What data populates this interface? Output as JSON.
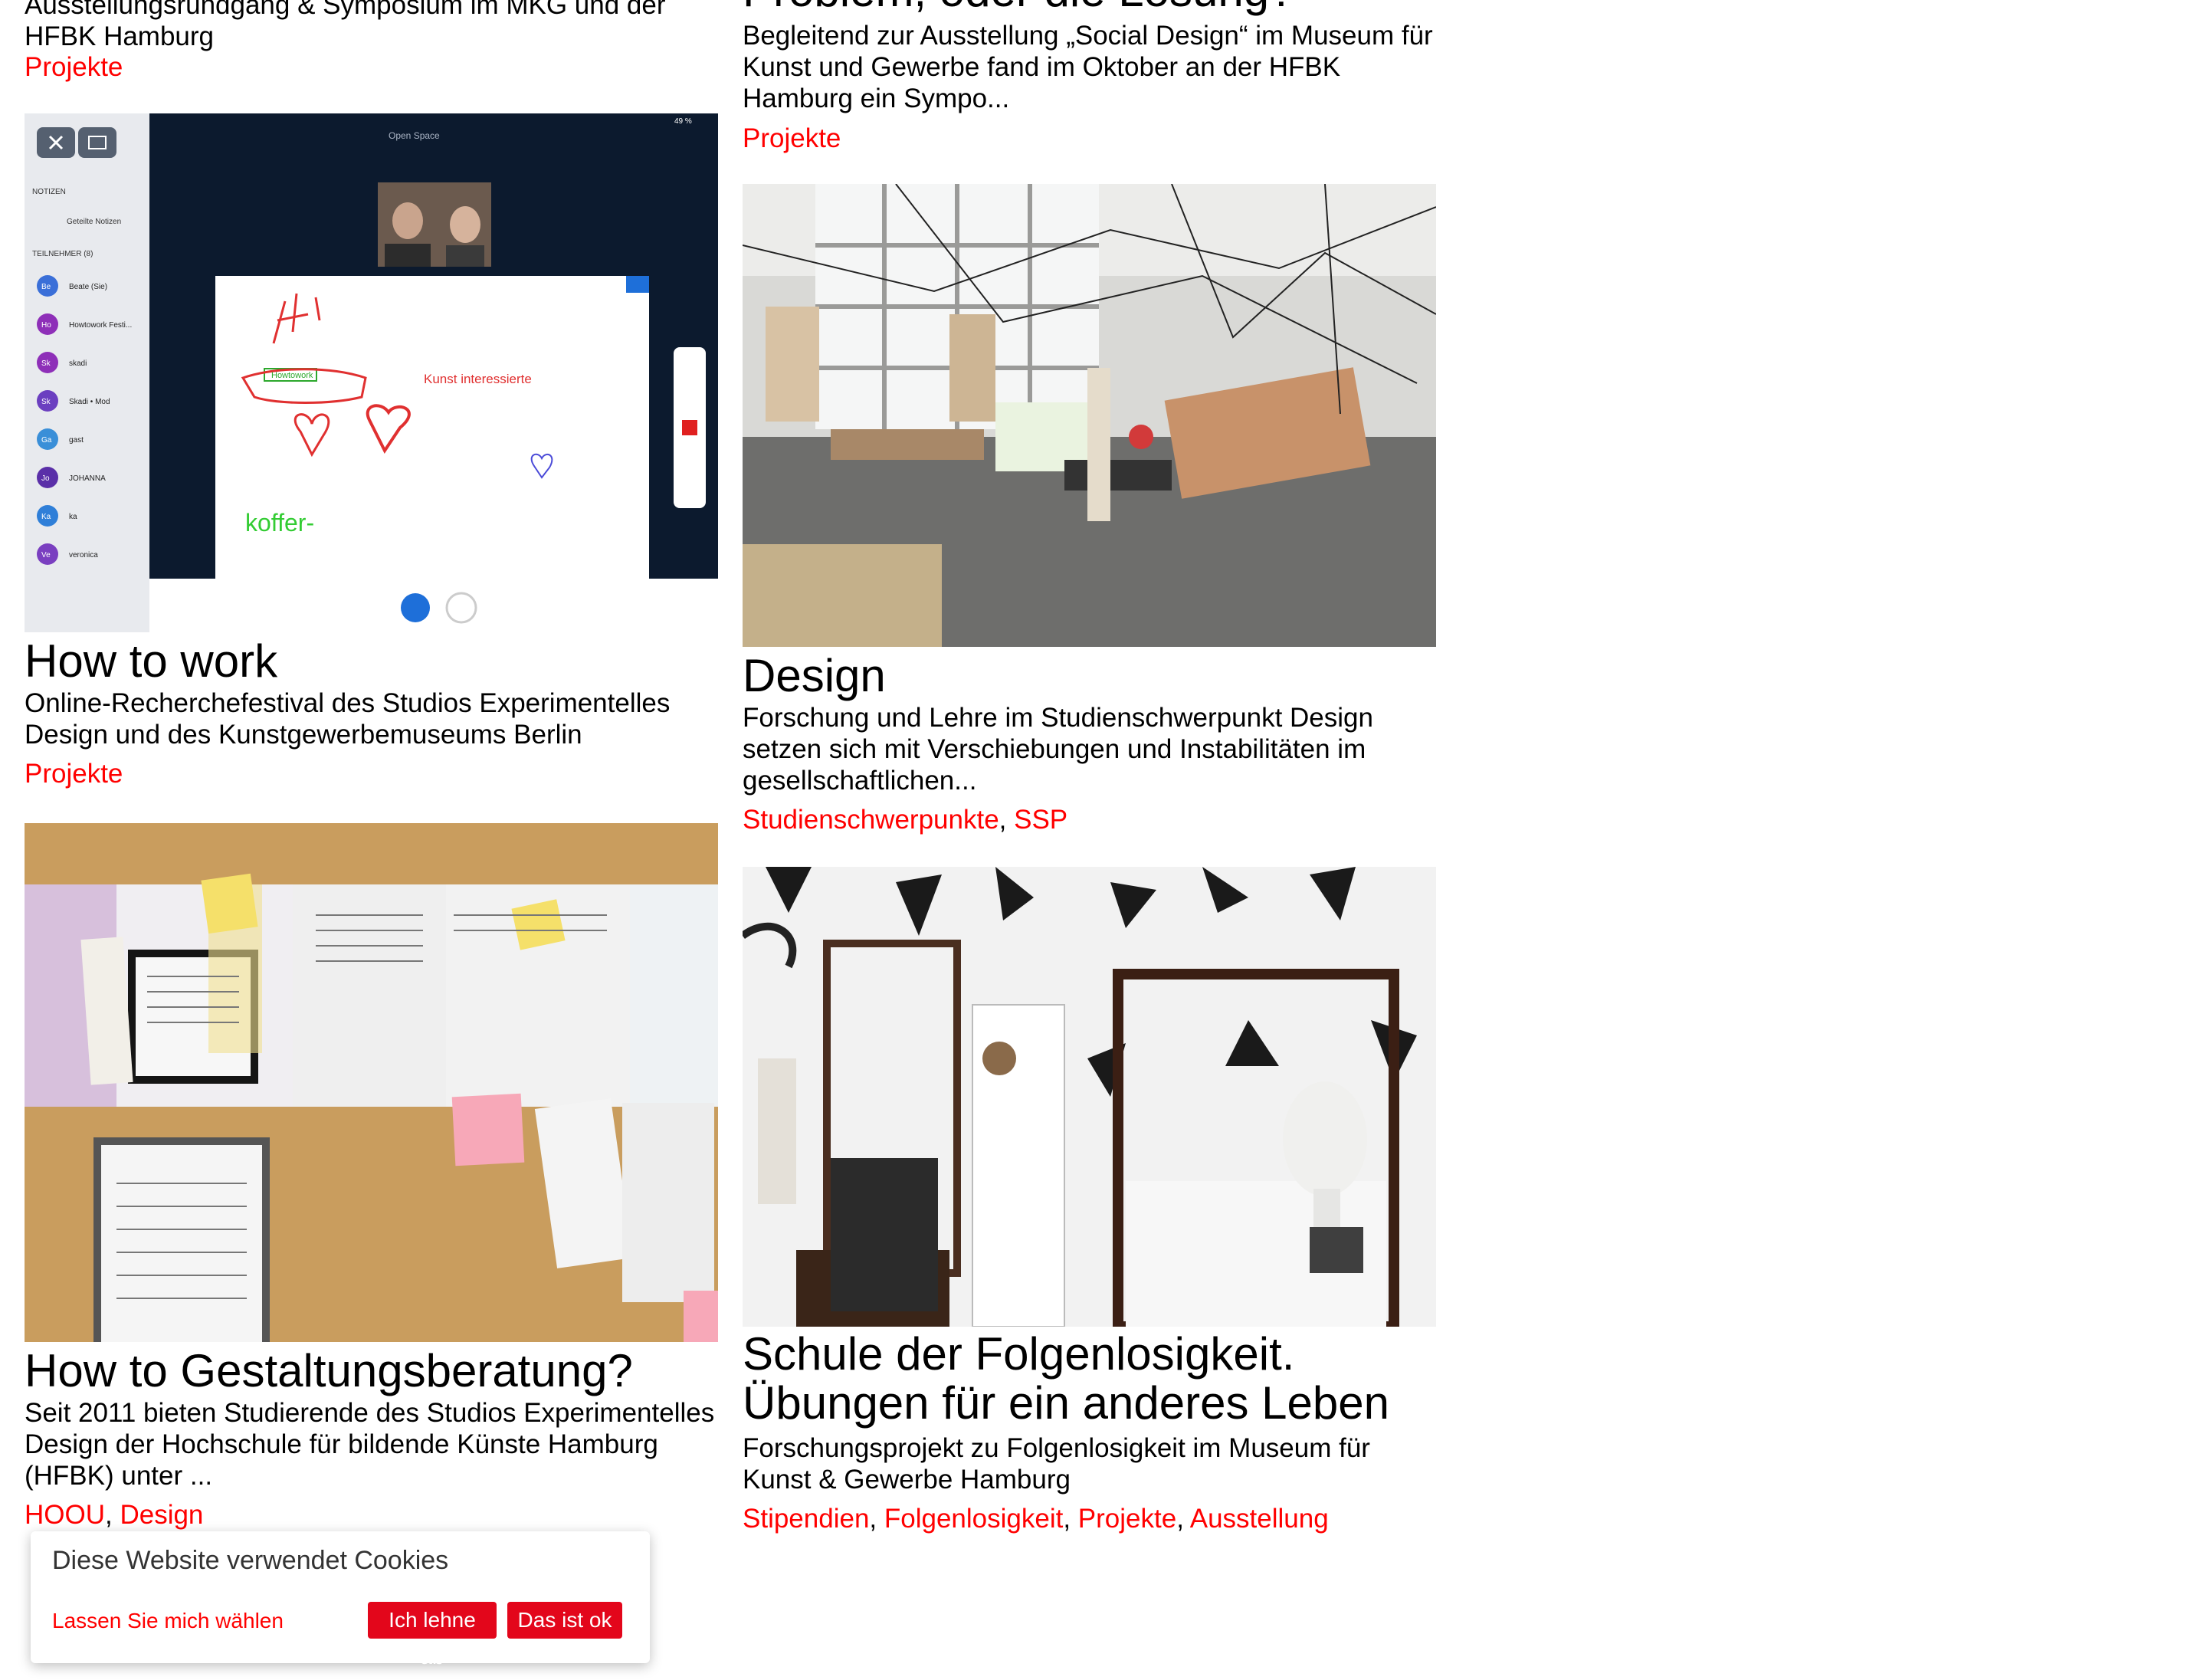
{
  "left_column": {
    "top_partial": {
      "desc": "Ausstellungsrundgang & Symposium im MKG und der HFBK Hamburg",
      "tags": [
        "Projekte"
      ]
    },
    "cards": [
      {
        "title": "How to work",
        "desc": "Online-Recherchefestival des Studios Experimentelles Design und des Kunstgewerbemuseums Berlin",
        "tags": [
          "Projekte"
        ],
        "image": {
          "top_bar": "Open Space",
          "battery": "49 %",
          "sidebar_sections": [
            "NOTIZEN",
            "TEILNEHMER (8)"
          ],
          "notes_item": "Geteilte Notizen",
          "participants": [
            {
              "initials": "Be",
              "name": "Beate (Sie)",
              "color": "#3a6fd8"
            },
            {
              "initials": "Ho",
              "name": "Howtowork Festi...",
              "color": "#8e2fb8"
            },
            {
              "initials": "Sk",
              "name": "skadi",
              "color": "#8e2fb8"
            },
            {
              "initials": "Sk",
              "name": "Skadi • Mod",
              "color": "#6b3fc0"
            },
            {
              "initials": "Ga",
              "name": "gast",
              "color": "#3a8fd8"
            },
            {
              "initials": "Jo",
              "name": "JOHANNA",
              "color": "#5a2fa8"
            },
            {
              "initials": "Ka",
              "name": "ka",
              "color": "#2f7fd8"
            },
            {
              "initials": "Ve",
              "name": "veronica",
              "color": "#7a3fc0"
            }
          ],
          "whiteboard_words": [
            "Howtowork",
            "Kunst interessierte",
            "koffer-"
          ]
        }
      },
      {
        "title": "How to Gestaltungsberatung?",
        "desc": "Seit 2011 bieten Studierende des Studios Experimentelles Design der Hochschule für bildende Künste Hamburg (HFBK) unter ...",
        "tags": [
          "HOOU",
          "Design"
        ]
      }
    ]
  },
  "right_column": {
    "top_partial": {
      "title": "Problem, oder die Lösung?",
      "desc": "Begleitend zur Ausstellung „Social Design“ im Museum für Kunst und Gewerbe fand im Oktober an der HFBK Hamburg ein Sympo...",
      "tags": [
        "Projekte"
      ]
    },
    "cards": [
      {
        "title": "Design",
        "desc": "Forschung und Lehre im Studienschwerpunkt Design setzen sich mit Verschiebungen und Instabilitäten im gesellschaftlichen...",
        "tags": [
          "Studienschwerpunkte",
          "SSP"
        ]
      },
      {
        "title": "Schule der Folgenlosigkeit. Übungen für ein anderes Leben",
        "desc": "Forschungsprojekt zu Folgenlosigkeit im Museum für Kunst & Gewerbe Hamburg",
        "tags": [
          "Stipendien",
          "Folgenlosigkeit",
          "Projekte",
          "Ausstellung"
        ]
      }
    ]
  },
  "cookie_banner": {
    "title": "Diese Website verwendet Cookies",
    "choose_label": "Lassen Sie mich wählen",
    "decline_label": "Ich lehne ab",
    "accept_label": "Das ist ok"
  },
  "colors": {
    "link": "#ff0000",
    "button_bg": "#e3061b",
    "app_dark": "#0c1a2e"
  }
}
